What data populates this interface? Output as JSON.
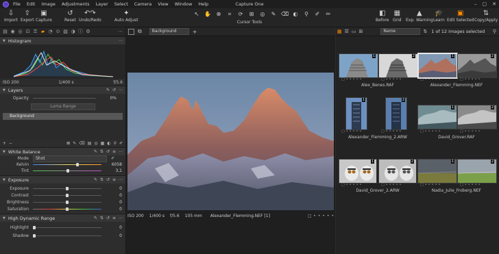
{
  "menu": {
    "items": [
      "File",
      "Edit",
      "Image",
      "Adjustments",
      "Layer",
      "Select",
      "Camera",
      "View",
      "Window",
      "Help"
    ],
    "app_title": "Capture One",
    "window_controls": [
      "–",
      "▢",
      "✕"
    ]
  },
  "toolbar": {
    "left": [
      {
        "label": "Import",
        "icon": "import-icon"
      },
      {
        "label": "Export",
        "icon": "export-icon"
      },
      {
        "label": "Capture",
        "icon": "camera-icon"
      },
      {
        "label": "Reset",
        "icon": "reset-icon"
      },
      {
        "label": "Undo/Redo",
        "icon": "undo-redo-icon"
      },
      {
        "label": "Auto Adjust",
        "icon": "auto-adjust-icon"
      }
    ],
    "cursor_tools_label": "Cursor Tools",
    "right": [
      {
        "label": "Before",
        "icon": "before-icon"
      },
      {
        "label": "Grid",
        "icon": "grid-icon"
      },
      {
        "label": "Exp. Warning",
        "icon": "exposure-warning-icon"
      },
      {
        "label": "Learn",
        "icon": "learn-icon"
      },
      {
        "label": "Edit Selected",
        "icon": "edit-selected-icon"
      },
      {
        "label": "Copy/Apply",
        "icon": "copy-apply-icon"
      }
    ]
  },
  "histogram": {
    "title": "Histogram",
    "iso": "ISO 200",
    "shutter": "1/400 s",
    "aperture": "f/5.6"
  },
  "layers": {
    "title": "Layers",
    "opacity_label": "Opacity",
    "opacity_value": "0%",
    "luma_range": "Luma Range",
    "background_layer": "Background"
  },
  "white_balance": {
    "title": "White Balance",
    "mode_label": "Mode",
    "mode_value": "Shot",
    "kelvin_label": "Kelvin",
    "kelvin_value": "6058",
    "tint_label": "Tint",
    "tint_value": "3,1",
    "kelvin_level": 0.66,
    "tint_level": 0.51
  },
  "exposure": {
    "title": "Exposure",
    "rows": [
      {
        "label": "Exposure",
        "value": "0",
        "level": 0.5
      },
      {
        "label": "Contrast",
        "value": "0",
        "level": 0.5
      },
      {
        "label": "Brightness",
        "value": "0",
        "level": 0.5
      },
      {
        "label": "Saturation",
        "value": "0",
        "level": 0.5
      }
    ]
  },
  "hdr": {
    "title": "High Dynamic Range",
    "rows": [
      {
        "label": "Highlight",
        "value": "0",
        "level": 0.0
      },
      {
        "label": "Shadow",
        "value": "0",
        "level": 0.0
      }
    ]
  },
  "viewer": {
    "layer_select": "Background",
    "info": {
      "iso": "ISO 200",
      "shutter": "1/400 s",
      "aperture": "f/5.6",
      "focal": "105 mm",
      "filename": "Alexander_Flemming.NEF [1]"
    }
  },
  "browser": {
    "sort_select": "Name",
    "count_text": "1 of 12 images selected",
    "captions": [
      "Alex_Benes.RAF",
      "Alexander_Flemming.NEF",
      "Alexander_Flemming_2.ARW",
      "David_Grover.RAF",
      "David_Grover_2.ARW",
      "Nadia_Julie_Froberg.NEF"
    ],
    "badges": [
      "1",
      "2",
      "1",
      "2",
      "1",
      "2",
      "1",
      "2",
      "1",
      "2",
      "1",
      "2"
    ]
  },
  "colors": {
    "accent": "#ff8a00",
    "panel": "#2d2d2d",
    "viewer_bg": "#1f1f1f"
  }
}
